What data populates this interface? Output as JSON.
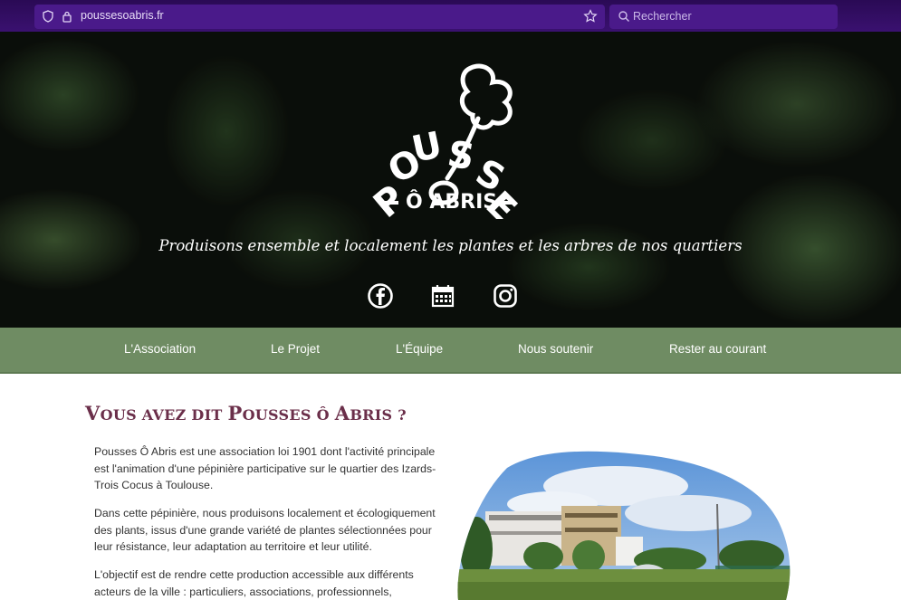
{
  "browser": {
    "url": "poussesoabris.fr",
    "search_placeholder": "Rechercher"
  },
  "hero": {
    "logo_alt": "POUSSES Ô ABRIS",
    "tagline": "Produisons ensemble et localement les plantes et les arbres de nos quartiers",
    "socials": [
      "facebook-icon",
      "calendar-icon",
      "instagram-icon"
    ]
  },
  "nav": {
    "items": [
      "L'Association",
      "Le Projet",
      "L'Équipe",
      "Nous soutenir",
      "Rester au courant"
    ]
  },
  "main": {
    "heading_first": "V",
    "heading_rest_1": "ous avez dit ",
    "heading_p": "P",
    "heading_rest_2": "ousses Ô ",
    "heading_a": "A",
    "heading_rest_3": "bris ?",
    "paragraphs": [
      "Pousses Ô Abris est une association loi 1901 dont l'activité principale est l'animation d'une pépinière participative sur le quartier des Izards-Trois Cocus à Toulouse.",
      "Dans cette pépinière, nous produisons localement et écologiquement des plants, issus d'une grande variété de plantes sélectionnées pour leur résistance, leur adaptation au territoire et leur utilité.",
      "L'objectif est de rendre cette production accessible aux différents acteurs de la ville : particuliers, associations, professionnels,"
    ]
  },
  "colors": {
    "nav_bg": "#6f8c63",
    "heading": "#6b2f4a",
    "chrome": "#3a1170"
  }
}
